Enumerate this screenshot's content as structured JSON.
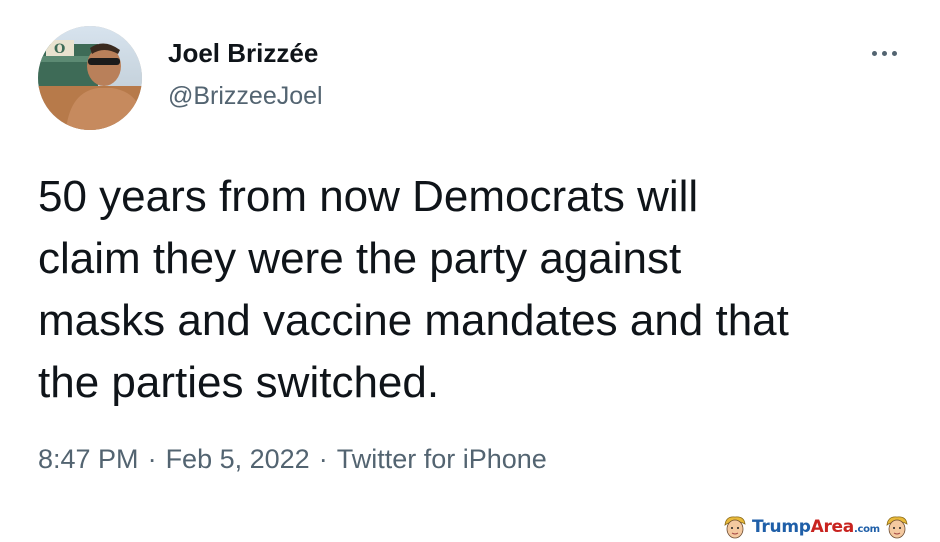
{
  "tweet": {
    "display_name": "Joel Brizzée",
    "handle": "@BrizzeeJoel",
    "text_lines": [
      "50 years from now Democrats will",
      "claim they were the party against",
      "masks and vaccine mandates and that",
      "the parties switched."
    ],
    "time": "8:47 PM",
    "separator": "·",
    "date": "Feb 5, 2022",
    "source": "Twitter for iPhone",
    "more_icon": "more-horizontal-icon"
  },
  "watermark": {
    "brand_part1": "Trump",
    "brand_part2": "Area",
    "brand_suffix": ".com",
    "colors": {
      "blue": "#1f5fa8",
      "red": "#c8231f"
    }
  },
  "colors": {
    "text_primary": "#0f1419",
    "text_secondary": "#536471",
    "background": "#ffffff"
  }
}
